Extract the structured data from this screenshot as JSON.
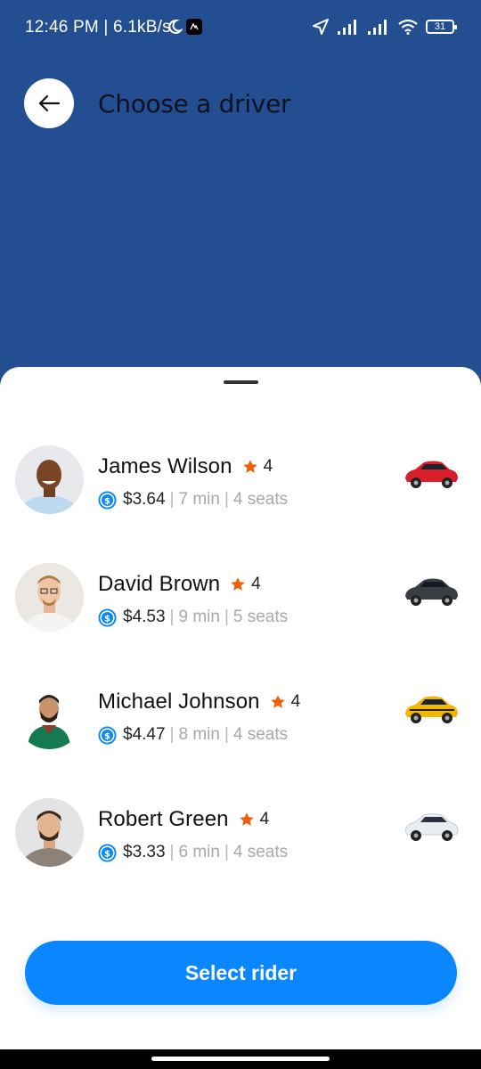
{
  "status_bar": {
    "time": "12:46 PM | 6.1kB/s",
    "battery": "31"
  },
  "header": {
    "title": "Choose a driver"
  },
  "drivers": [
    {
      "name": "James Wilson",
      "rating": "4",
      "price": "$3.64",
      "eta": "7 min",
      "seats": "4 seats",
      "car_color": "#d81f2b"
    },
    {
      "name": "David Brown",
      "rating": "4",
      "price": "$4.53",
      "eta": "9 min",
      "seats": "5 seats",
      "car_color": "#3a3d42"
    },
    {
      "name": "Michael Johnson",
      "rating": "4",
      "price": "$4.47",
      "eta": "8 min",
      "seats": "4 seats",
      "car_color": "#f2b705"
    },
    {
      "name": "Robert Green",
      "rating": "4",
      "price": "$3.33",
      "eta": "6 min",
      "seats": "4 seats",
      "car_color": "#e8edf2"
    }
  ],
  "actions": {
    "select_label": "Select rider"
  },
  "colors": {
    "header_bg": "#234e91",
    "accent": "#0a86ff",
    "star": "#f25c05"
  }
}
